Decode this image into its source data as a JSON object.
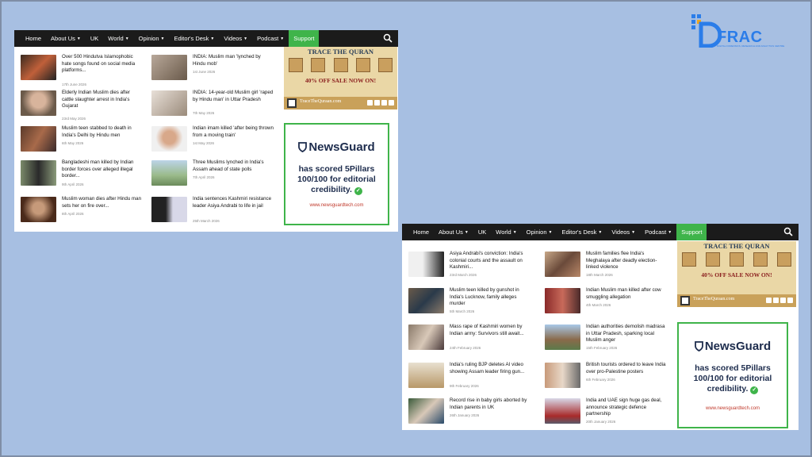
{
  "logo": {
    "name": "FRAC",
    "tagline": "DIGITAL FORENSICS, RESEARCH AND ANALYTICS CENTRE"
  },
  "nav": {
    "items": [
      "Home",
      "About Us",
      "UK",
      "World",
      "Opinion",
      "Editor's Desk",
      "Videos",
      "Podcast"
    ],
    "support": "Support"
  },
  "screenshot1": {
    "col1": [
      {
        "title": "Over 500 Hindutva Islamophobic hate songs found on social media platforms...",
        "date": "17th June 2026"
      },
      {
        "title": "Elderly Indian Muslim dies after cattle slaughter arrest in India's Gujarat",
        "date": "23rd May 2026"
      },
      {
        "title": "Muslim teen stabbed to death in India's Delhi by Hindu men",
        "date": "6th May 2026"
      },
      {
        "title": "Bangladeshi man killed by Indian border forces over alleged illegal border...",
        "date": "9th April 2026"
      },
      {
        "title": "Muslim woman dies after Hindu man sets her on fire over...",
        "date": "8th April 2026"
      }
    ],
    "col2": [
      {
        "title": "INDIA: Muslim man 'lynched by Hindu mob'",
        "date": "1st June 2026"
      },
      {
        "title": "INDIA: 14-year-old Muslim girl 'raped by Hindu man' in Uttar Pradesh",
        "date": "7th May 2026"
      },
      {
        "title": "Indian imam killed 'after being thrown from a moving train'",
        "date": "1st May 2026"
      },
      {
        "title": "Three Muslims lynched in India's Assam ahead of state polls",
        "date": "7th April 2026"
      },
      {
        "title": "India sentences Kashmiri resistance leader Asiya Andrabi to life in jail",
        "date": "25th March 2026"
      }
    ]
  },
  "screenshot2": {
    "col1": [
      {
        "title": "Asiya Andrabi's conviction: India's colonial courts and the assault on Kashmiri...",
        "date": "23rd March 2026"
      },
      {
        "title": "Muslim teen killed by gunshot in India's Lucknow, family alleges murder",
        "date": "5th March 2026"
      },
      {
        "title": "Mass rape of Kashmiri women by Indian army: Survivors still await...",
        "date": "24th February 2026"
      },
      {
        "title": "India's ruling BJP deletes AI video showing Assam leader firing gun...",
        "date": "9th February 2026"
      },
      {
        "title": "Record rise in baby girls aborted by Indian parents in UK",
        "date": "26th January 2026"
      }
    ],
    "col2": [
      {
        "title": "Muslim families flee India's Meghalaya after deadly election-linked violence",
        "date": "18th March 2026"
      },
      {
        "title": "Indian Muslim man killed after cow smuggling allegation",
        "date": "4th March 2026"
      },
      {
        "title": "Indian authorities demolish madrasa in Uttar Pradesh, sparking local Muslim anger",
        "date": "15th February 2026"
      },
      {
        "title": "British tourists ordered to leave India over pro-Palestine posters",
        "date": "6th February 2026"
      },
      {
        "title": "India and UAE sign huge gas deal, announce strategic defence partnership",
        "date": "20th January 2026"
      }
    ]
  },
  "ad": {
    "title": "TRACE THE QURAN",
    "sale": "40% OFF SALE NOW ON!",
    "url": "TraceTheQuraan.com"
  },
  "newsguard": {
    "brand": "NewsGuard",
    "line1": "has scored 5Pillars",
    "line2": "100/100 for editorial",
    "line3": "credibility.",
    "url": "www.newsguardtech.com"
  },
  "colors": {
    "nav_bg": "#1b1b1b",
    "support": "#3fb44a",
    "page_bg": "#a7bfe2",
    "frac_blue": "#2b7de9"
  }
}
